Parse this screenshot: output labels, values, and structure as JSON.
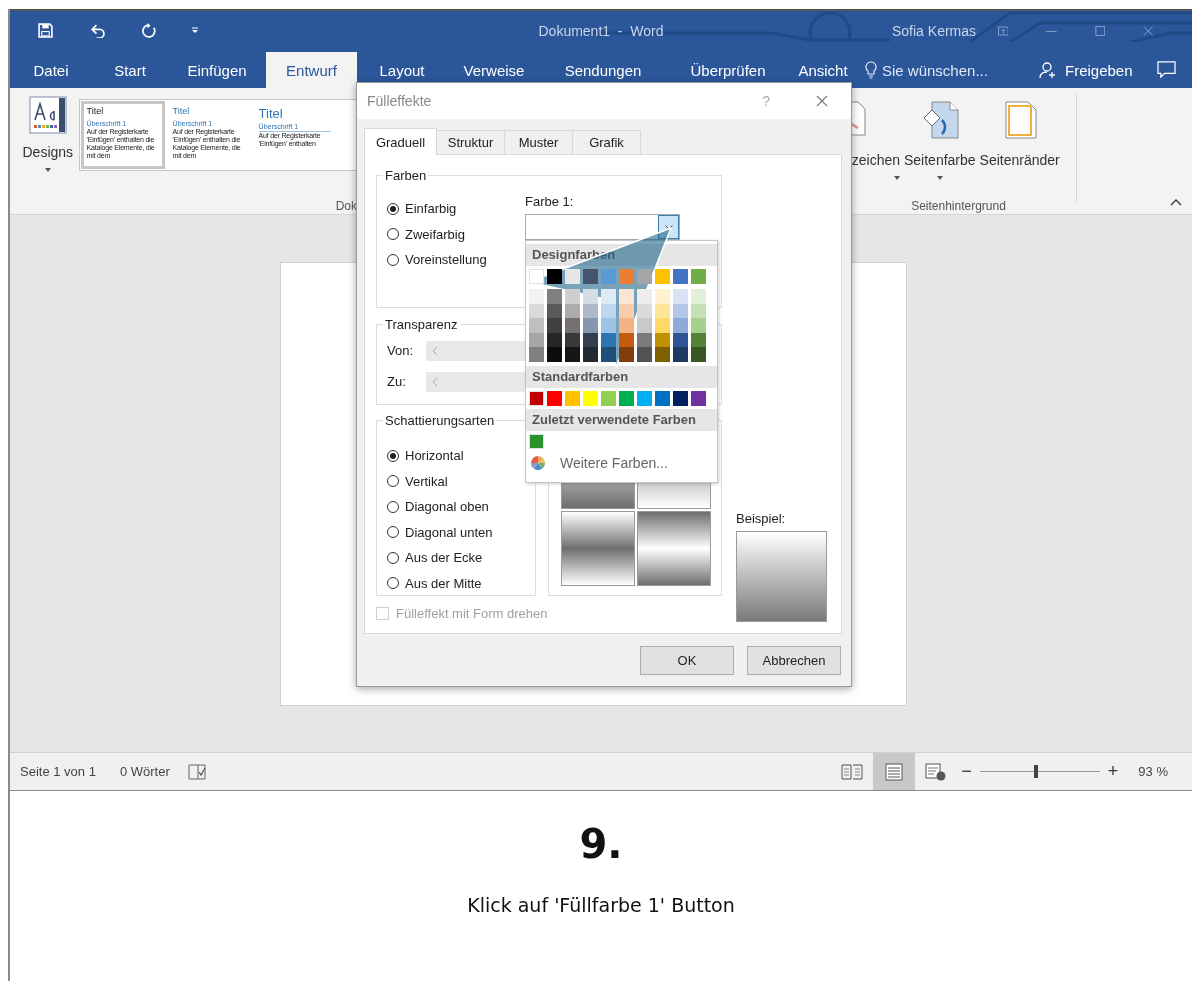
{
  "window": {
    "title": "Dokument1  -  Word",
    "user": "Sofia Kermas"
  },
  "ribbon_tabs": [
    {
      "label": "Datei",
      "selected": false
    },
    {
      "label": "Start",
      "selected": false
    },
    {
      "label": "Einfügen",
      "selected": false
    },
    {
      "label": "Entwurf",
      "selected": true
    },
    {
      "label": "Layout",
      "selected": false
    },
    {
      "label": "Verweise",
      "selected": false
    },
    {
      "label": "Sendungen",
      "selected": false
    },
    {
      "label": "Überprüfen",
      "selected": false
    },
    {
      "label": "Ansicht",
      "selected": false
    }
  ],
  "tell_me": {
    "placeholder": "Sie wünschen..."
  },
  "share": "Freigeben",
  "ribbon": {
    "designs": "Designs",
    "style_gallery": [
      {
        "kind": "basic",
        "selected": true,
        "title": "Titel",
        "heading": "Überschrift 1",
        "body": "Auf der Registerkarte 'Einfügen' enthalten die Kataloge Elemente, die mit dem"
      },
      {
        "kind": "blue",
        "selected": false,
        "title": "Titel",
        "heading": "Überschrift 1",
        "body": "Auf der Registerkarte 'Einfügen' enthalten die Kataloge Elemente, die mit dem"
      },
      {
        "kind": "large",
        "selected": false,
        "title": "Titel",
        "heading": "Überschrift 1",
        "body": "Auf der Registerkarte 'Einfügen' enthalten"
      }
    ],
    "group_label": "Dok",
    "background_buttons": [
      {
        "kind": "watermark",
        "label": "zeichen"
      },
      {
        "kind": "page-color",
        "label": "Seitenfarbe"
      },
      {
        "kind": "borders",
        "label": "Seitenränder"
      }
    ],
    "background_group_label": "Seitenhintergrund"
  },
  "status_bar": {
    "page": "Seite 1 von 1",
    "words": "0 Wörter",
    "views": [
      {
        "kind": "read",
        "selected": false
      },
      {
        "kind": "print",
        "selected": true
      },
      {
        "kind": "web",
        "selected": false
      }
    ],
    "zoom": {
      "minus": "−",
      "plus": "+",
      "level": 0.47,
      "reading": "93 %"
    }
  },
  "dialog": {
    "title": "Fülleffekte",
    "help": "?",
    "tabs": [
      {
        "label": "Graduell",
        "selected": true
      },
      {
        "label": "Struktur",
        "selected": false
      },
      {
        "label": "Muster",
        "selected": false
      },
      {
        "label": "Grafik",
        "selected": false
      }
    ],
    "colors_group": {
      "label": "Farben",
      "options": [
        {
          "label": "Einfarbig",
          "selected": true
        },
        {
          "label": "Zweifarbig",
          "selected": false
        },
        {
          "label": "Voreinstellung",
          "selected": false
        }
      ],
      "color1_label": "Farbe 1:"
    },
    "transparency_group": {
      "label": "Transparenz",
      "from_label": "Von:",
      "to_label": "Zu:"
    },
    "shading_group": {
      "label": "Schattierungsarten",
      "options": [
        {
          "label": "Horizontal",
          "selected": true
        },
        {
          "label": "Vertikal",
          "selected": false
        },
        {
          "label": "Diagonal oben",
          "selected": false
        },
        {
          "label": "Diagonal unten",
          "selected": false
        },
        {
          "label": "Aus der Ecke",
          "selected": false
        },
        {
          "label": "Aus der Mitte",
          "selected": false
        }
      ]
    },
    "variants": [
      {
        "kind": "fade-down"
      },
      {
        "kind": "fade-up"
      },
      {
        "kind": "band-dark"
      },
      {
        "kind": "band-light"
      }
    ],
    "sample_label": "Beispiel:",
    "rotate_checkbox": {
      "label": "Fülleffekt mit Form drehen",
      "checked": false,
      "disabled": true
    },
    "buttons": [
      "OK",
      "Abbrechen"
    ]
  },
  "color_menu": {
    "theme_heading": "Designfarben",
    "theme_colors": [
      {
        "color": "#ffffff",
        "shades": [
          {
            "color": "#f2f2f2"
          },
          {
            "color": "#d9d9d9"
          },
          {
            "color": "#bfbfbf"
          },
          {
            "color": "#a6a6a6"
          },
          {
            "color": "#808080"
          }
        ]
      },
      {
        "color": "#000000",
        "shades": [
          {
            "color": "#808080"
          },
          {
            "color": "#595959"
          },
          {
            "color": "#404040"
          },
          {
            "color": "#262626"
          },
          {
            "color": "#0d0d0d"
          }
        ]
      },
      {
        "color": "#e7e6e6",
        "shades": [
          {
            "color": "#d0cece"
          },
          {
            "color": "#aeabab"
          },
          {
            "color": "#757171"
          },
          {
            "color": "#3a3838"
          },
          {
            "color": "#171616"
          }
        ]
      },
      {
        "color": "#44546a",
        "shades": [
          {
            "color": "#d6dce4"
          },
          {
            "color": "#adb9ca"
          },
          {
            "color": "#8496b0"
          },
          {
            "color": "#333f4f"
          },
          {
            "color": "#222a35"
          }
        ]
      },
      {
        "color": "#5b9bd5",
        "shades": [
          {
            "color": "#deebf6"
          },
          {
            "color": "#bdd7ee"
          },
          {
            "color": "#9dc3e6"
          },
          {
            "color": "#2e75b5"
          },
          {
            "color": "#1f4e79"
          }
        ]
      },
      {
        "color": "#ed7d31",
        "shades": [
          {
            "color": "#fbe5d5"
          },
          {
            "color": "#f7cbac"
          },
          {
            "color": "#f4b183"
          },
          {
            "color": "#c55a11"
          },
          {
            "color": "#833c0b"
          }
        ]
      },
      {
        "color": "#a5a5a5",
        "shades": [
          {
            "color": "#ededed"
          },
          {
            "color": "#dbdbdb"
          },
          {
            "color": "#c9c9c9"
          },
          {
            "color": "#7b7b7b"
          },
          {
            "color": "#525252"
          }
        ]
      },
      {
        "color": "#ffc000",
        "shades": [
          {
            "color": "#fff2cc"
          },
          {
            "color": "#fee599"
          },
          {
            "color": "#ffd965"
          },
          {
            "color": "#bf9000"
          },
          {
            "color": "#7f6000"
          }
        ]
      },
      {
        "color": "#4472c4",
        "shades": [
          {
            "color": "#dae3f3"
          },
          {
            "color": "#b4c7e7"
          },
          {
            "color": "#8eaadb"
          },
          {
            "color": "#2f5496"
          },
          {
            "color": "#1f3864"
          }
        ]
      },
      {
        "color": "#70ad47",
        "shades": [
          {
            "color": "#e2efd9"
          },
          {
            "color": "#c5e0b3"
          },
          {
            "color": "#a8d08d"
          },
          {
            "color": "#538135"
          },
          {
            "color": "#375623"
          }
        ]
      }
    ],
    "standard_heading": "Standardfarben",
    "standard_colors": [
      {
        "color": "#c00000"
      },
      {
        "color": "#ff0000"
      },
      {
        "color": "#ffc000"
      },
      {
        "color": "#ffff00"
      },
      {
        "color": "#92d050"
      },
      {
        "color": "#00b050"
      },
      {
        "color": "#00b0f0"
      },
      {
        "color": "#0070c0"
      },
      {
        "color": "#002060"
      },
      {
        "color": "#7030a0"
      }
    ],
    "recent_heading": "Zuletzt verwendete Farben",
    "recent_colors": [
      {
        "color": "#2a922a"
      }
    ],
    "more": "Weitere Farben..."
  },
  "caption": {
    "step": "9.",
    "text": "Klick auf 'Füllfarbe 1' Button"
  }
}
